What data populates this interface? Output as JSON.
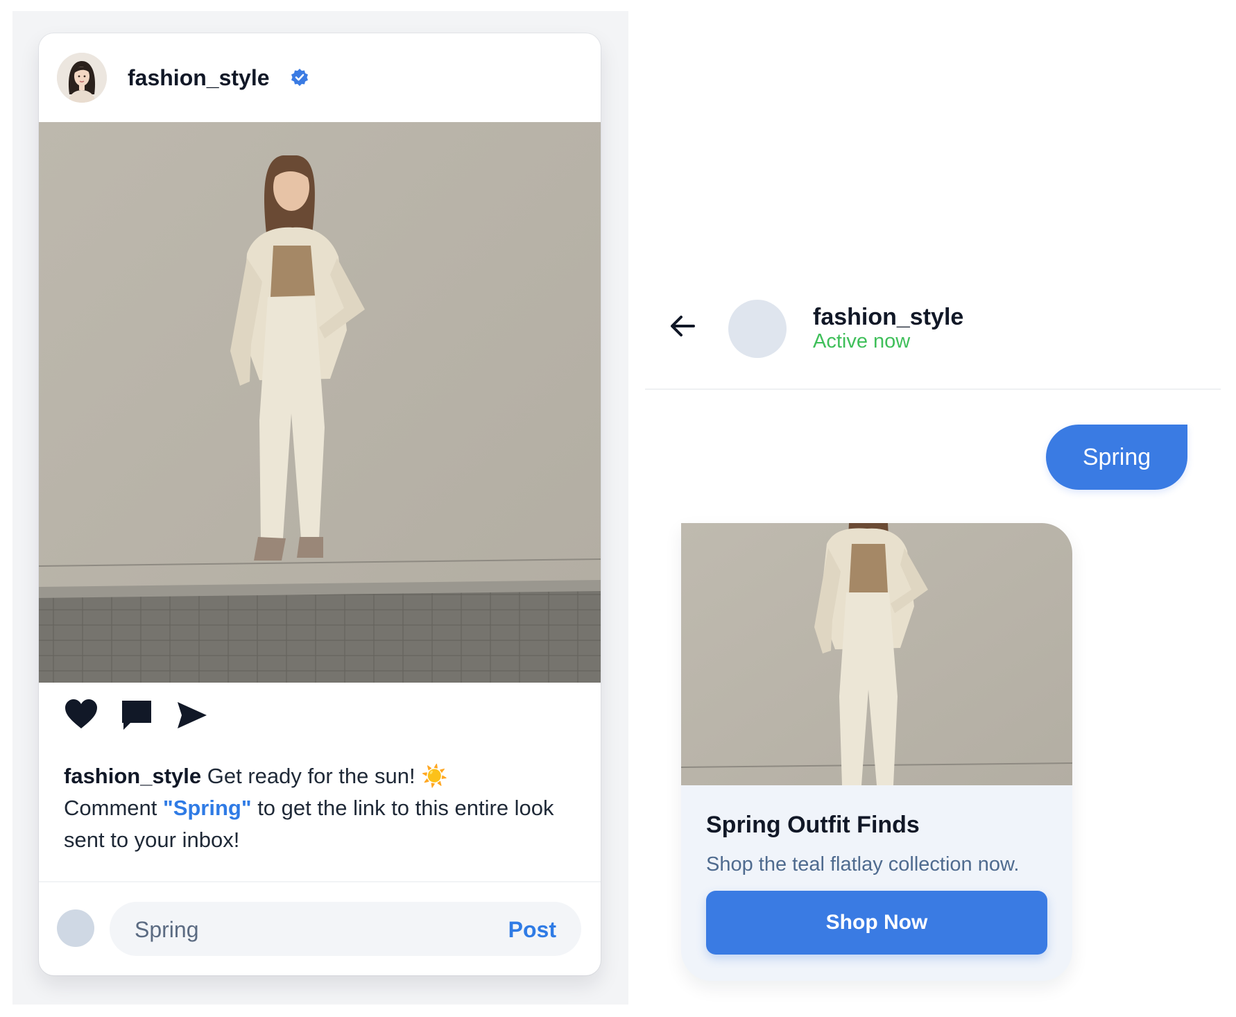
{
  "post": {
    "username": "fashion_style",
    "verified_icon": "verified-badge-icon",
    "caption_user": "fashion_style",
    "caption_line1": "Get ready for the sun! ☀️",
    "caption_pre": "Comment",
    "caption_keyword": "\"Spring\"",
    "caption_post": "to get the link to this entire look sent to your inbox!",
    "actions": [
      "heart-icon",
      "comment-icon",
      "send-icon"
    ],
    "comment": {
      "value": "Spring",
      "post_label": "Post"
    }
  },
  "chat": {
    "name": "fashion_style",
    "status": "Active now",
    "sent_message": "Spring",
    "card": {
      "title": "Spring Outfit Finds",
      "subtitle": "Shop the teal flatlay collection now.",
      "button_label": "Shop Now"
    }
  },
  "colors": {
    "accent": "#3a7be3",
    "link": "#2f7be5",
    "status_green": "#3fbf5a",
    "wall": "#bbb6aa"
  }
}
